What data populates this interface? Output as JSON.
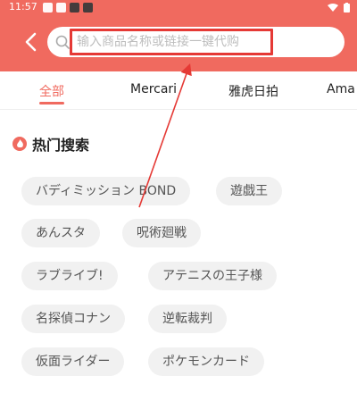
{
  "status_bar": {
    "time": "11:57"
  },
  "search": {
    "placeholder": "输入商品名称或链接一键代购"
  },
  "tabs": [
    {
      "label": "全部",
      "active": true
    },
    {
      "label": "Mercari"
    },
    {
      "label": "雅虎日拍"
    },
    {
      "label": "Ama"
    }
  ],
  "hot_search": {
    "title": "热门搜索",
    "chips": [
      "バディミッション BOND",
      "遊戯王",
      "あんスタ",
      "呪術廻戦",
      "ラブライブ!",
      "アテニスの王子様",
      "名探偵コナン",
      "逆転裁判",
      "仮面ライダー",
      "ポケモンカード"
    ]
  },
  "colors": {
    "brand": "#f06a5f",
    "highlight": "#e53935"
  }
}
